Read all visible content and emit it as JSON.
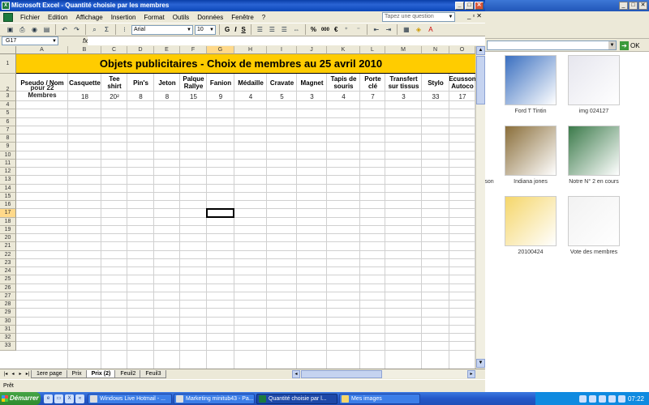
{
  "window": {
    "title": "Microsoft Excel - Quantité choisie par les membres",
    "controls": [
      "_",
      "□",
      "✕"
    ]
  },
  "menu": {
    "items": [
      "Fichier",
      "Edition",
      "Affichage",
      "Insertion",
      "Format",
      "Outils",
      "Données",
      "Fenêtre",
      "?"
    ],
    "help_placeholder": "Tapez une question",
    "doc_controls": [
      "_",
      "▫",
      "✕"
    ]
  },
  "toolbar": {
    "font": "Arial",
    "size": "10",
    "bold": "G",
    "italic": "I",
    "underline": "S",
    "sigma": "Σ",
    "percent": "%",
    "thousands": "000",
    "euro": "€"
  },
  "formula_bar": {
    "name_box": "G17",
    "fx": "fx",
    "value": ""
  },
  "sheet": {
    "columns": [
      "A",
      "B",
      "C",
      "D",
      "E",
      "F",
      "G",
      "H",
      "I",
      "J",
      "K",
      "L",
      "M",
      "N",
      "O"
    ],
    "rows": [
      "1",
      "2",
      "3",
      "4",
      "5",
      "6",
      "7",
      "8",
      "9",
      "10",
      "11",
      "12",
      "13",
      "14",
      "15",
      "16",
      "17",
      "18",
      "19",
      "20",
      "21",
      "22",
      "23",
      "24",
      "25",
      "26",
      "27",
      "28",
      "29",
      "30",
      "31",
      "32",
      "33"
    ],
    "banner": "Objets publicitaires - Choix de membres au 25 avril 2010",
    "headers": [
      "Pseudo / Nom",
      "Casquette",
      "Tee shirt",
      "Pin's",
      "Jeton",
      "Palque Rallye",
      "Fanion",
      "Médaille",
      "Cravate",
      "Magnet",
      "Tapis de souris",
      "Porte clé",
      "Transfert sur tissus",
      "Stylo",
      "Ecusson Autoco"
    ],
    "row3_label": "pour 22 Membres",
    "row3_values": [
      "18",
      "20²",
      "8",
      "8",
      "15",
      "9",
      "4",
      "5",
      "3",
      "4",
      "7",
      "3",
      "33",
      "17"
    ],
    "selected_cell": "G17"
  },
  "sheet_tabs": {
    "nav": [
      "|◂",
      "◂",
      "▸",
      "▸|"
    ],
    "tabs": [
      "1ere page",
      "Prix",
      "Prix (2)",
      "Feuil2",
      "Feuil3"
    ],
    "active": "Prix (2)"
  },
  "status": {
    "text": "Prêt"
  },
  "explorer": {
    "go_label": "OK",
    "thumbnails": [
      {
        "label": "Ford T Tintin",
        "color": "#3a6fc0"
      },
      {
        "label": "img 024127",
        "color": "#e6e6ee"
      },
      {
        "label": "Indiana jones",
        "color": "#8a6e3a"
      },
      {
        "label": "Notre N° 2 en cours",
        "color": "#3b7a4a"
      },
      {
        "label": "20100424",
        "color": "#f5d66a"
      },
      {
        "label": "Vote des membres",
        "color": "#f2f2f2"
      },
      {
        "label": "son",
        "color": "#aaaaaa"
      }
    ]
  },
  "taskbar": {
    "start": "Démarrer",
    "tasks": [
      "Windows Live Hotmail - ...",
      "Marketing minitub43 - Pa...",
      "Quantité choisie par l...",
      "Mes images"
    ],
    "active_task": "Quantité choisie par l...",
    "clock": "07:22",
    "chevron": "«"
  }
}
